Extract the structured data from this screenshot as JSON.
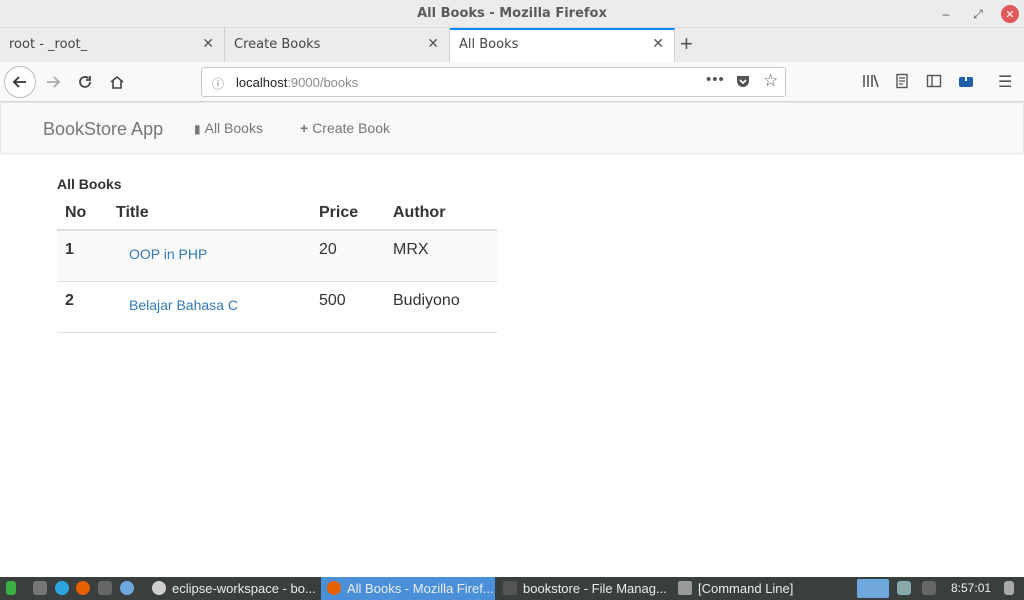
{
  "window": {
    "title": "All Books - Mozilla Firefox"
  },
  "tabs": [
    {
      "label": "root - _root_"
    },
    {
      "label": "Create Books"
    },
    {
      "label": "All Books"
    }
  ],
  "urlbar": {
    "host": "localhost",
    "path": ":9000/books"
  },
  "app": {
    "brand": "BookStore App",
    "nav": [
      {
        "label": "All Books",
        "icon": "book-icon"
      },
      {
        "label": "Create Book",
        "icon": "plus-icon"
      }
    ]
  },
  "page": {
    "heading": "All Books",
    "columns": [
      "No",
      "Title",
      "Price",
      "Author"
    ],
    "rows": [
      {
        "no": "1",
        "title": "OOP in PHP",
        "price": "20",
        "author": "MRX"
      },
      {
        "no": "2",
        "title": "Belajar Bahasa C",
        "price": "500",
        "author": "Budiyono"
      }
    ]
  },
  "taskbar": {
    "tasks": [
      {
        "label": "eclipse-workspace - bo..."
      },
      {
        "label": "All Books - Mozilla Firef..."
      },
      {
        "label": "bookstore - File Manag..."
      },
      {
        "label": "[Command Line]"
      }
    ],
    "clock": "8:57:01"
  },
  "colors": {
    "accent": "#0a84ff",
    "link": "#337ab7",
    "taskbar": "#393f3f",
    "active_task": "#4a90d9"
  }
}
